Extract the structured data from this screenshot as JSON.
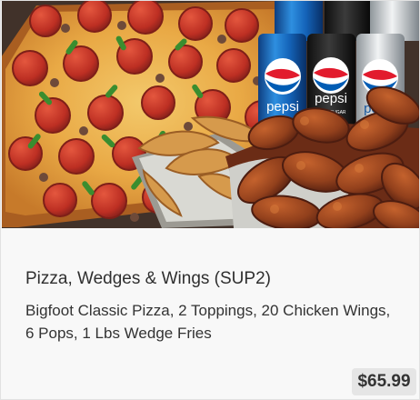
{
  "card": {
    "image_alt": "Pizza, Wedges & Wings (SUP2) product image",
    "image_text": {
      "pepsi": "pepsi",
      "zero_sugar": "ZERO SUGAR",
      "diet_pepsi": "pepsi",
      "diet": "diet"
    },
    "title": "Pizza, Wedges & Wings (SUP2)",
    "description": "Bigfoot Classic Pizza, 2 Toppings, 20 Chicken Wings, 6 Pops, 1 Lbs Wedge Fries",
    "price": "$65.99"
  },
  "colors": {
    "pizza_crust": "#b8702c",
    "pepperoni": "#b72b22",
    "green_pepper": "#3a8d2f",
    "pepsi_blue": "#1463b8",
    "wing_sauce": "#8a3719",
    "potato": "#d69a4c",
    "price_bg": "#e5e5e5"
  }
}
